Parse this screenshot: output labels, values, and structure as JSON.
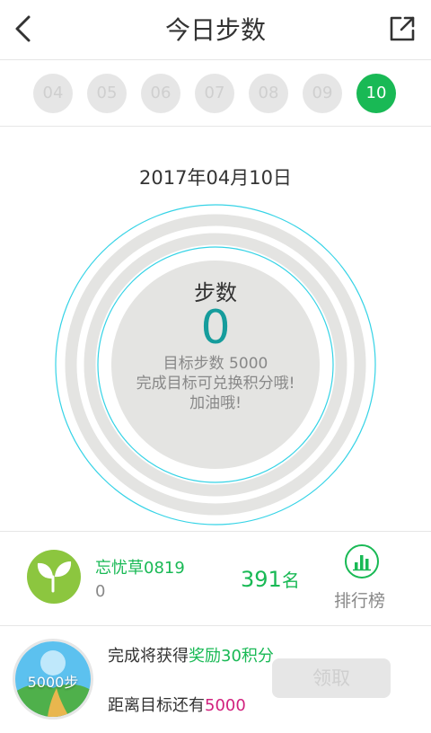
{
  "header": {
    "title": "今日步数",
    "back_icon": "chevron-left-icon",
    "share_icon": "share-icon"
  },
  "dates": [
    "04",
    "05",
    "06",
    "07",
    "08",
    "09",
    "10"
  ],
  "active_date_index": 6,
  "full_date": "2017年04月10日",
  "steps": {
    "label": "步数",
    "value": "0",
    "goal_line": "目标步数 5000",
    "hint_line1": "完成目标可兑换积分哦!",
    "hint_line2": "加油哦!"
  },
  "ranking": {
    "user_name": "忘忧草0819",
    "user_steps": "0",
    "rank_number": "391",
    "rank_suffix": "名",
    "leaderboard_label": "排行榜",
    "leaderboard_icon": "bar-chart-icon"
  },
  "reward": {
    "badge_text": "5000步",
    "line1_prefix": "完成将获得",
    "line1_highlight": "奖励30积分",
    "line2_prefix": "距离目标还有",
    "line2_value": "5000",
    "claim_label": "领取"
  },
  "colors": {
    "accent_green": "#19b955",
    "steps_teal": "#159c9c",
    "ring_cyan": "#35d3e6",
    "pink": "#d1217e"
  }
}
